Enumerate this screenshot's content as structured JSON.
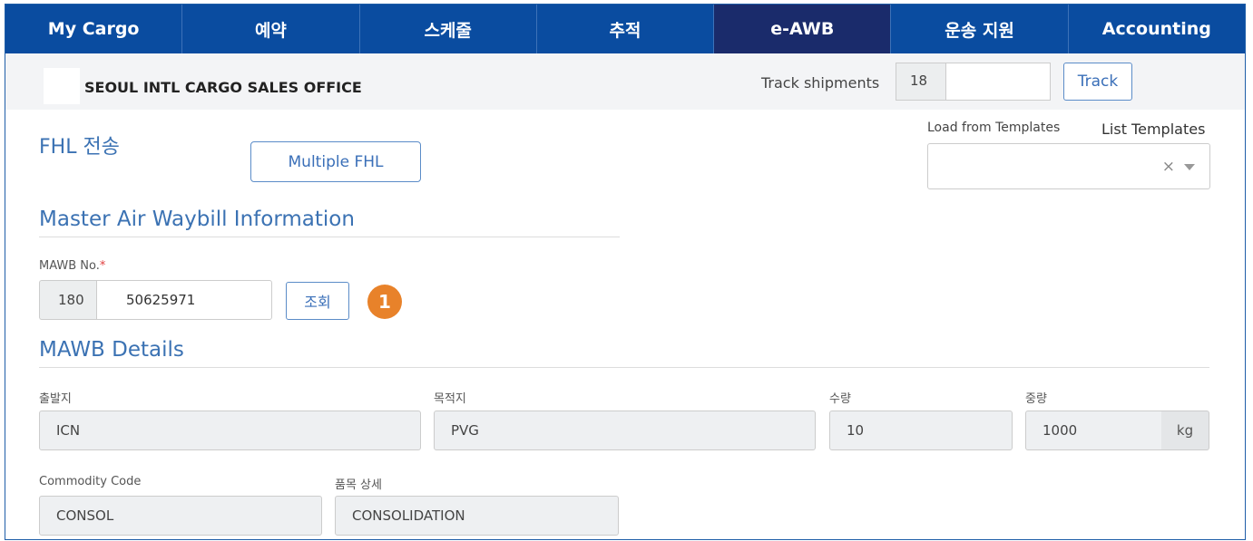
{
  "nav": {
    "items": [
      {
        "label": "My Cargo"
      },
      {
        "label": "예약"
      },
      {
        "label": "스케줄"
      },
      {
        "label": "추적"
      },
      {
        "label": "e-AWB"
      },
      {
        "label": "운송 지원"
      },
      {
        "label": "Accounting"
      }
    ],
    "active": "e-AWB"
  },
  "subbar": {
    "office_name": "SEOUL INTL CARGO SALES OFFICE",
    "track_label": "Track shipments",
    "track_prefix": "18",
    "track_value": "",
    "track_button": "Track"
  },
  "page": {
    "title": "FHL 전송",
    "multiple_fhl_button": "Multiple FHL"
  },
  "templates": {
    "label": "Load from Templates",
    "list_link": "List Templates",
    "selected": "",
    "clear_glyph": "×"
  },
  "mawb_info": {
    "section_title": "Master Air Waybill Information",
    "field_label": "MAWB No.",
    "required_mark": "*",
    "prefix": "180",
    "number": "50625971",
    "lookup_button": "조회",
    "step_badge": "1"
  },
  "mawb_details": {
    "section_title": "MAWB Details",
    "origin_label": "출발지",
    "origin": "ICN",
    "destination_label": "목적지",
    "destination": "PVG",
    "pieces_label": "수량",
    "pieces": "10",
    "weight_label": "중량",
    "weight": "1000",
    "weight_unit": "kg",
    "commodity_code_label": "Commodity Code",
    "commodity_code": "CONSOL",
    "commodity_desc_label": "품목 상세",
    "commodity_desc": "CONSOLIDATION"
  },
  "colors": {
    "nav_bg": "#0a4ca0",
    "nav_active_bg": "#1a2b6b",
    "accent_text": "#3b72b3",
    "badge": "#e8822a"
  }
}
